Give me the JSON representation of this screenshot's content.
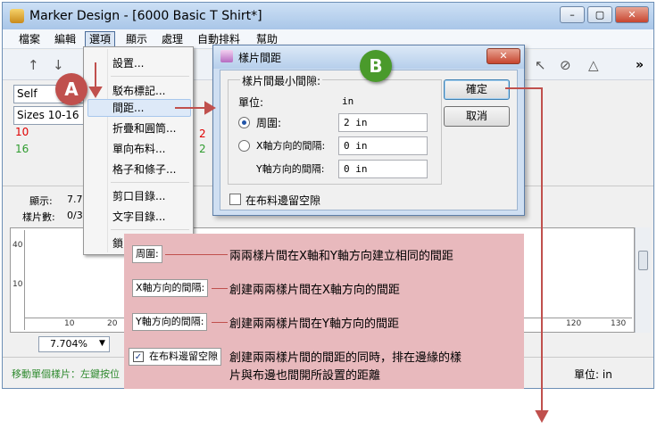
{
  "app": {
    "title": "Marker Design - [6000 Basic T Shirt*]",
    "window_buttons": [
      "–",
      "▢",
      "✕"
    ]
  },
  "menu": [
    "檔案",
    "編輯",
    "選項",
    "顯示",
    "處理",
    "自動排料",
    "幫助"
  ],
  "toolbar": {
    "collapse": "»"
  },
  "left_panel": {
    "combo_self": "Self",
    "combo_sizes": "Sizes 10-16",
    "size_rows": [
      {
        "size": "10",
        "color": "#e00000"
      },
      {
        "size": "16",
        "color": "#2f9c2f"
      }
    ],
    "partial_digits": [
      "2",
      "2"
    ]
  },
  "info": {
    "display_label": "顯示:",
    "display_value": "7.7",
    "pieces_label": "樣片數:",
    "pieces_value": "0/3"
  },
  "ruler": {
    "left_marks": [
      "40",
      "10"
    ],
    "bottom_marks": [
      "10",
      "20",
      "120",
      "130"
    ]
  },
  "zoom": {
    "value": "7.704%",
    "arrow": "▼"
  },
  "status": {
    "left": "移動單個樣片：左鍵按位",
    "unit": "單位: in"
  },
  "dropdown": {
    "items": [
      "設置...",
      "駁布標記...",
      "間距...",
      "折疊和圓筒...",
      "單向布料...",
      "格子和條子...",
      "剪口目錄...",
      "文字目錄...",
      "鎖"
    ]
  },
  "dialog": {
    "title": "樣片間距",
    "close": "✕",
    "group_title": "樣片間最小間隙:",
    "unit_label": "單位:",
    "unit_value": "in",
    "circle_label": "周圍:",
    "circle_value": "2 in",
    "x_label": "X軸方向的間隔:",
    "x_value": "0 in",
    "y_label": "Y軸方向的間隔:",
    "y_value": "0 in",
    "checkbox_label": "在布料邊留空隙",
    "ok": "確定",
    "cancel": "取消"
  },
  "badges": {
    "a": "A",
    "b": "B"
  },
  "overlay": {
    "rows": [
      {
        "tag": "周圍:",
        "text": "兩兩樣片間在X軸和Y軸方向建立相同的間距"
      },
      {
        "tag": "X軸方向的間隔:",
        "text": "創建兩兩樣片間在X軸方向的間距"
      },
      {
        "tag": "Y軸方向的間隔:",
        "text": "創建兩兩樣片間在Y軸方向的間距"
      }
    ],
    "check_tag": "在布料邊留空隙",
    "check_text_1": "創建兩兩樣片間的間距的同時，排在邊緣的樣",
    "check_text_2": "片與布邊也間開所設置的距離"
  },
  "colors": {
    "overlay": "#e8b9bd",
    "annotation_line": "#c0504d",
    "badge_a": "#c0504d",
    "badge_b": "#4a9a2b"
  }
}
